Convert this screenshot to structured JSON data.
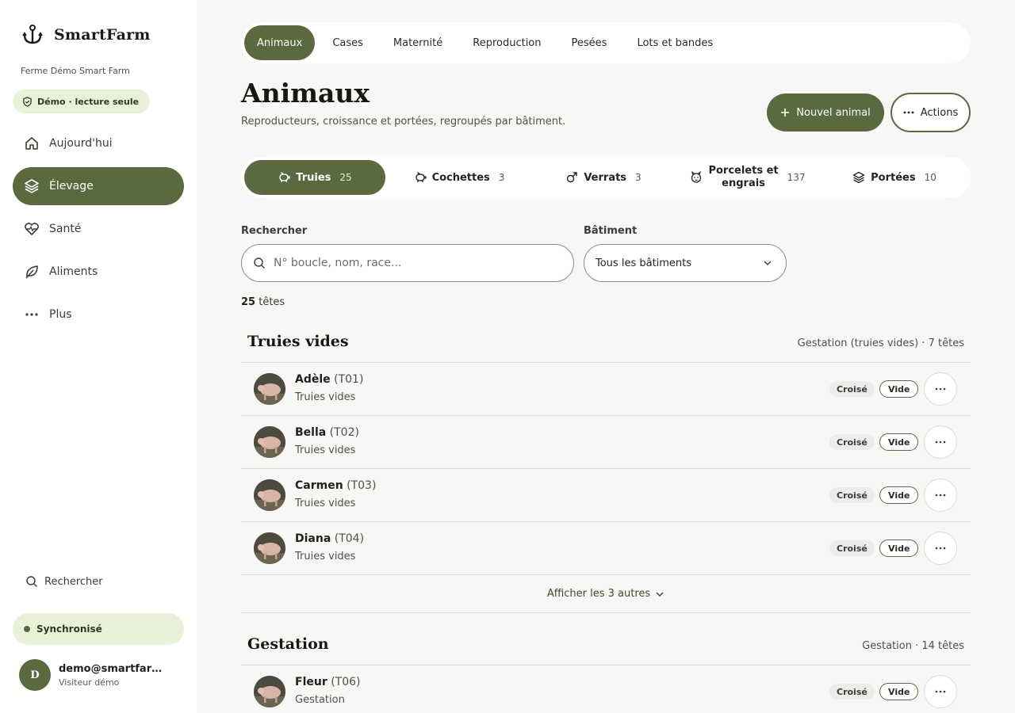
{
  "app": {
    "name": "SmartFarm",
    "farm_name": "Ferme Démo Smart Farm",
    "demo_badge": "Démo · lecture seule"
  },
  "sidebar": {
    "items": [
      {
        "label": "Aujourd'hui",
        "icon": "home-icon"
      },
      {
        "label": "Élevage",
        "icon": "layers-icon",
        "active": true
      },
      {
        "label": "Santé",
        "icon": "heart-pulse-icon"
      },
      {
        "label": "Aliments",
        "icon": "leaf-icon"
      },
      {
        "label": "Plus",
        "icon": "more-icon"
      }
    ],
    "search_label": "Rechercher",
    "sync_label": "Synchronisé",
    "user": {
      "initial": "D",
      "email": "demo@smartfarm.g...",
      "role": "Visiteur démo"
    }
  },
  "topnav": {
    "tabs": [
      {
        "label": "Animaux",
        "active": true
      },
      {
        "label": "Cases"
      },
      {
        "label": "Maternité"
      },
      {
        "label": "Reproduction"
      },
      {
        "label": "Pesées"
      },
      {
        "label": "Lots et bandes"
      }
    ]
  },
  "header": {
    "title": "Animaux",
    "subtitle": "Reproducteurs, croissance et portées, regroupés par bâtiment.",
    "primary_button": "Nouvel animal",
    "secondary_button": "Actions"
  },
  "categories": [
    {
      "label": "Truies",
      "count": "25",
      "icon": "pig-icon",
      "active": true
    },
    {
      "label": "Cochettes",
      "count": "3",
      "icon": "pig-icon"
    },
    {
      "label": "Verrats",
      "count": "3",
      "icon": "male-icon"
    },
    {
      "label": "Porcelets et engrais",
      "line1": "Porcelets et",
      "line2": "engrais",
      "count": "137",
      "icon": "piglet-icon"
    },
    {
      "label": "Portées",
      "count": "10",
      "icon": "layers-icon"
    }
  ],
  "filters": {
    "search_label": "Rechercher",
    "search_placeholder": "N° boucle, nom, race...",
    "building_label": "Bâtiment",
    "building_value": "Tous les bâtiments"
  },
  "summary": {
    "count": "25",
    "unit": "têtes"
  },
  "sections": [
    {
      "title": "Truies vides",
      "meta": "Gestation (truies vides) · 7 têtes",
      "rows": [
        {
          "name": "Adèle",
          "tag": "(T01)",
          "group": "Truies vides",
          "breed": "Croisé",
          "status": "Vide"
        },
        {
          "name": "Bella",
          "tag": "(T02)",
          "group": "Truies vides",
          "breed": "Croisé",
          "status": "Vide"
        },
        {
          "name": "Carmen",
          "tag": "(T03)",
          "group": "Truies vides",
          "breed": "Croisé",
          "status": "Vide"
        },
        {
          "name": "Diana",
          "tag": "(T04)",
          "group": "Truies vides",
          "breed": "Croisé",
          "status": "Vide"
        }
      ],
      "show_more": "Afficher les 3 autres"
    },
    {
      "title": "Gestation",
      "meta": "Gestation · 14 têtes",
      "rows": [
        {
          "name": "Fleur",
          "tag": "(T06)",
          "group": "Gestation",
          "breed": "Croisé",
          "status": "Vide"
        }
      ]
    }
  ],
  "colors": {
    "accent": "#5a6a3e",
    "accent_light": "#e9f2d9",
    "background": "#f7f7f5"
  }
}
